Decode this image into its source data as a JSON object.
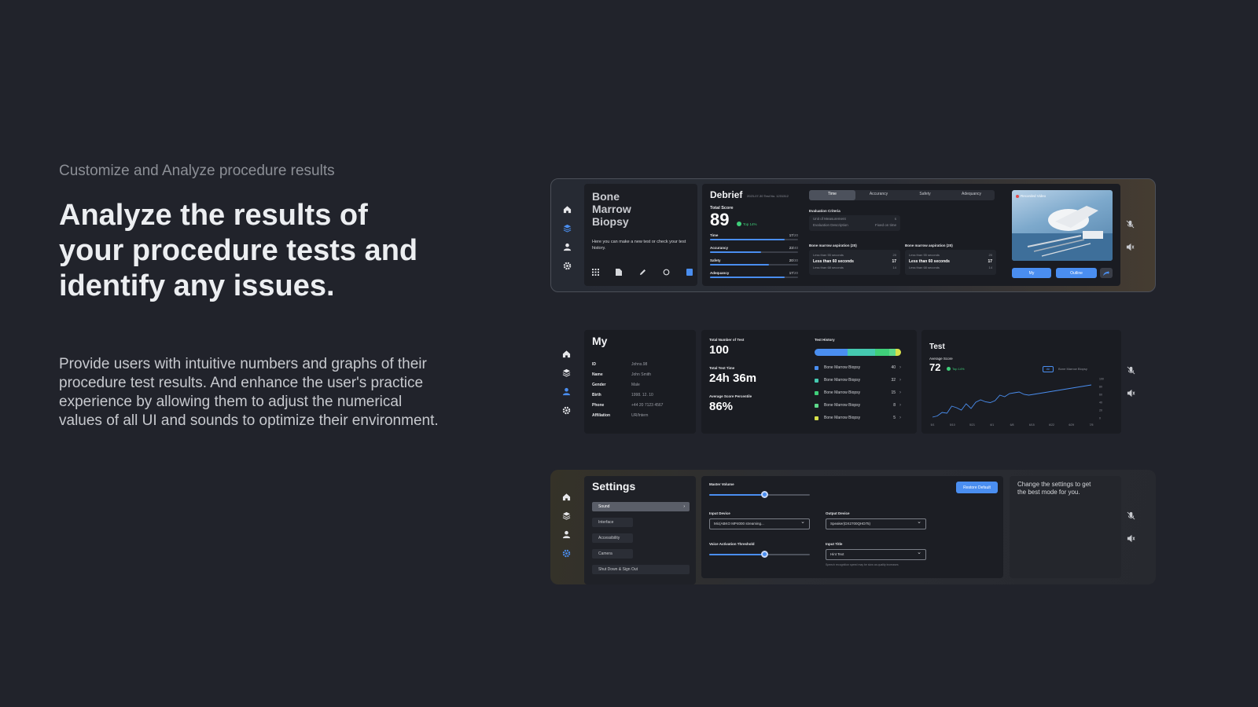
{
  "intro": {
    "eyebrow": "Customize and Analyze procedure results",
    "headline": [
      "Analyze the results of",
      "your procedure tests and",
      "identify any issues."
    ],
    "description": [
      "Provide users with intuitive numbers and graphs of their",
      "procedure test results. And enhance the user's practice",
      "experience by allowing them to adjust the numerical",
      "values of all UI and sounds to optimize their environment."
    ]
  },
  "colors": {
    "background": "#21232b",
    "accent": "#4a8ef0",
    "panel": "#1a1c22",
    "success": "#3fcf7a"
  },
  "nav_icons": [
    "home-icon",
    "layers-icon",
    "user-icon",
    "gear-icon"
  ],
  "debrief": {
    "procedure_title": [
      "Bone",
      "Marrow",
      "Biopsy"
    ],
    "procedure_hint": "Here you can make a new test or check your test history.",
    "procedure_tools": [
      "",
      "",
      "",
      "",
      ""
    ],
    "title": "Debrief",
    "meta": "2023-07-30 Test No. 1231312",
    "total_score_label": "Total Score",
    "total_score": "89",
    "top_badge": "Top 14%",
    "metrics": [
      {
        "label": "Time",
        "value": "17",
        "max": "/20",
        "fraction": 0.85
      },
      {
        "label": "Accurancy",
        "value": "23",
        "max": "/40",
        "fraction": 0.58
      },
      {
        "label": "Safety",
        "value": "20",
        "max": "/30",
        "fraction": 0.67
      },
      {
        "label": "Adequancy",
        "value": "17",
        "max": "/20",
        "fraction": 0.85
      }
    ],
    "tabs": [
      "Time",
      "Accurancy",
      "Safety",
      "Adequancy"
    ],
    "active_tab": 0,
    "criteria_label": "Evaluation Criteria",
    "criteria_rows": [
      {
        "label": "Unit of Measurement",
        "value": "s"
      },
      {
        "label": "Evaluation Description",
        "value": "Fixed on time"
      }
    ],
    "aspiration_cards": [
      {
        "title": "Bone marrow aspiration (20)",
        "rows": [
          {
            "label": "Less than 55 seconds",
            "score": "20",
            "bold": false
          },
          {
            "label": "Less than 60 seconds",
            "score": "17",
            "bold": true
          },
          {
            "label": "Less than 68 seconds",
            "score": "14",
            "bold": false
          }
        ]
      },
      {
        "title": "Bone marrow aspiration (20)",
        "rows": [
          {
            "label": "Less than 55 seconds",
            "score": "20",
            "bold": false
          },
          {
            "label": "Less than 60 seconds",
            "score": "17",
            "bold": true
          },
          {
            "label": "Less than 68 seconds",
            "score": "14",
            "bold": false
          }
        ]
      }
    ],
    "video_label": "Recorded Video",
    "video_buttons": [
      "My",
      "Outline"
    ]
  },
  "profile": {
    "title": "My",
    "fields": [
      {
        "key": "ID",
        "value": "Johns.98"
      },
      {
        "key": "Name",
        "value": "John Smith"
      },
      {
        "key": "Gender",
        "value": "Male"
      },
      {
        "key": "Birth",
        "value": "1998. 12. 10"
      },
      {
        "key": "Phone",
        "value": "+44 20 7123 4567"
      },
      {
        "key": "Affiliation",
        "value": "UR/Intern"
      }
    ],
    "stats": [
      {
        "label": "Total Number of Test",
        "value": "100"
      },
      {
        "label": "Total Test Time",
        "value": "24h 36m"
      },
      {
        "label": "Average Score Percentile",
        "value": "86%"
      }
    ],
    "history_label": "Test History",
    "history_segments": [
      {
        "share": 0.38,
        "color": "#4a8ef0"
      },
      {
        "share": 0.32,
        "color": "#45c9b0"
      },
      {
        "share": 0.16,
        "color": "#3fcf7a"
      },
      {
        "share": 0.08,
        "color": "#5ed98a"
      },
      {
        "share": 0.06,
        "color": "#d6e04a"
      }
    ],
    "history": [
      {
        "name": "Bone Marrow Biopsy",
        "count": "40",
        "color": "#4a8ef0"
      },
      {
        "name": "Bone Marrow Biopsy",
        "count": "32",
        "color": "#45c9b0"
      },
      {
        "name": "Bone Marrow Biopsy",
        "count": "15",
        "color": "#3fcf7a"
      },
      {
        "name": "Bone Marrow Biopsy",
        "count": "8",
        "color": "#5ed98a"
      },
      {
        "name": "Bone Marrow Biopsy",
        "count": "5",
        "color": "#d6e04a"
      }
    ]
  },
  "test_chart": {
    "title": "Test",
    "avg_label": "Average Score",
    "avg_value": "72",
    "top_badge": "Top 14%",
    "filter_all": "All",
    "filter_value": "Bone Marrow Biopsy",
    "chart_data": {
      "type": "line",
      "title": "",
      "x": [
        "5/1",
        "5/10",
        "5/21",
        "6/1",
        "6/8",
        "6/15",
        "6/22",
        "6/29",
        "7/5"
      ],
      "y_ticks": [
        0,
        20,
        40,
        60,
        80,
        100
      ],
      "ylim": [
        0,
        100
      ],
      "series": [
        {
          "values": [
            2,
            5,
            14,
            12,
            30,
            26,
            20,
            36,
            24,
            40,
            46,
            41,
            39,
            44,
            58,
            54,
            62,
            64,
            66,
            60,
            58,
            60,
            62,
            64,
            66,
            68,
            70,
            72,
            74,
            76,
            78,
            80,
            82,
            84
          ]
        }
      ],
      "grid": false
    }
  },
  "settings": {
    "title": "Settings",
    "menu": [
      "Sound",
      "Interface",
      "Accessibility",
      "Camera",
      "Shut Down & Sign Out"
    ],
    "active": 0,
    "master_label": "Master Volume",
    "master_value": 0.55,
    "restore_label": "Restore Default",
    "input_device_label": "Input Device",
    "input_device_value": "Mic(ABKO MP4000 streaming...",
    "output_device_label": "Output Device",
    "output_device_value": "Speaker(DX2700QHD75)",
    "threshold_label": "Voice Activation Threshold",
    "threshold_value": 0.55,
    "input_title_label": "Input Title",
    "input_title_value": "Hint Text",
    "input_title_hint": "Speech recognition speed may be slow as quality increases",
    "side_note": [
      "Change the settings to get",
      "the best mode for you."
    ]
  }
}
